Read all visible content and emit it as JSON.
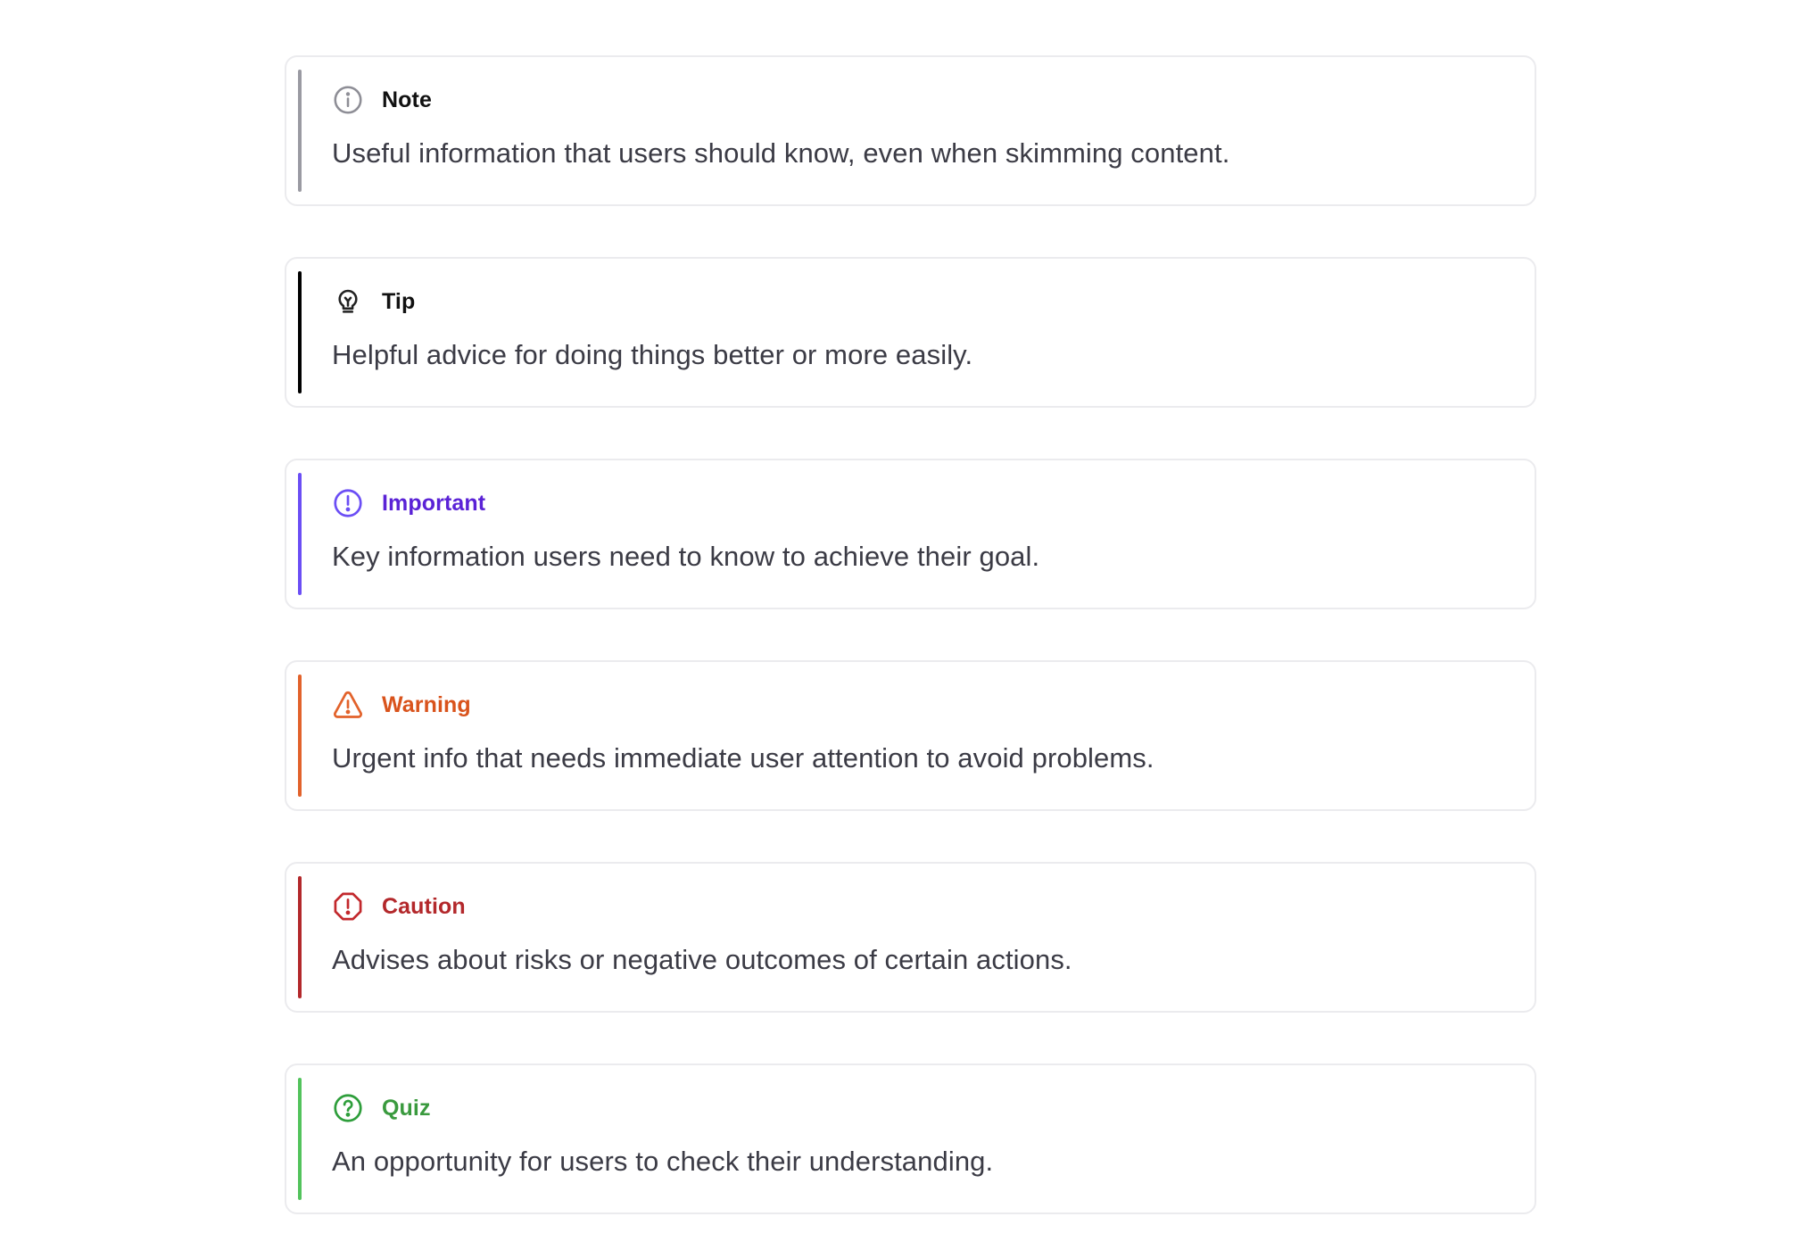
{
  "callouts": [
    {
      "key": "note",
      "icon": "info-icon",
      "title": "Note",
      "text": "Useful information that users should know, even when skimming content.",
      "accent": "#9a9aa2",
      "icon_color": "#8e8e96",
      "title_color": "#111111"
    },
    {
      "key": "tip",
      "icon": "lightbulb-icon",
      "title": "Tip",
      "text": "Helpful advice for doing things better or more easily.",
      "accent": "#000000",
      "icon_color": "#222222",
      "title_color": "#111111"
    },
    {
      "key": "important",
      "icon": "exclamation-circle-icon",
      "title": "Important",
      "text": "Key information users need to know to achieve their goal.",
      "accent": "#6b4ef5",
      "icon_color": "#6b4ef5",
      "title_color": "#5a22d6"
    },
    {
      "key": "warning",
      "icon": "warning-triangle-icon",
      "title": "Warning",
      "text": "Urgent info that needs immediate user attention to avoid problems.",
      "accent": "#e2622b",
      "icon_color": "#e2622b",
      "title_color": "#d9531c"
    },
    {
      "key": "caution",
      "icon": "stop-octagon-icon",
      "title": "Caution",
      "text": "Advises about risks or negative outcomes of certain actions.",
      "accent": "#b3282b",
      "icon_color": "#c2282c",
      "title_color": "#b3282b"
    },
    {
      "key": "quiz",
      "icon": "question-circle-icon",
      "title": "Quiz",
      "text": "An opportunity for users to check their understanding.",
      "accent": "#52c35c",
      "icon_color": "#2e9e3b",
      "title_color": "#3a9a3e"
    }
  ]
}
